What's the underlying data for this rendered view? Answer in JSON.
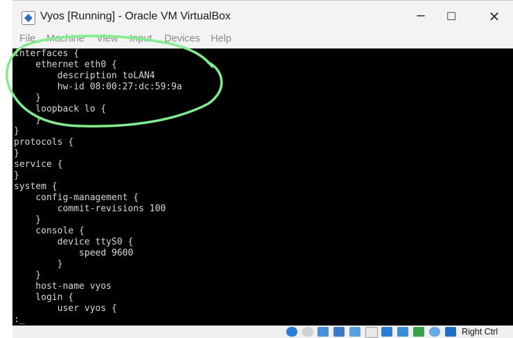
{
  "window": {
    "title": "Vyos [Running] - Oracle VM VirtualBox",
    "controls": [
      "minimize-icon",
      "maximize-icon",
      "close-icon"
    ]
  },
  "menu": [
    "File",
    "Machine",
    "View",
    "Input",
    "Devices",
    "Help"
  ],
  "terminal": {
    "lines": [
      "interfaces {",
      "    ethernet eth0 {",
      "        description toLAN4",
      "        hw-id 08:00:27:dc:59:9a",
      "    }",
      "    loopback lo {",
      "    }",
      "}",
      "protocols {",
      "}",
      "service {",
      "}",
      "system {",
      "    config-management {",
      "        commit-revisions 100",
      "    }",
      "    console {",
      "        device ttyS0 {",
      "            speed 9600",
      "        }",
      "    }",
      "    host-name vyos",
      "    login {",
      "        user vyos {",
      ":_"
    ]
  },
  "statusbar": {
    "icons": [
      "disk-icon",
      "cdrom-icon",
      "audio-icon",
      "network-icon",
      "usb-icon",
      "shared-folder-icon",
      "display-icon",
      "recording-icon",
      "cpu-icon",
      "mouse-integration-icon",
      "keyboard-icon"
    ],
    "host_key": "Right Ctrl"
  },
  "annotation": {
    "color": "#7cf08a"
  }
}
